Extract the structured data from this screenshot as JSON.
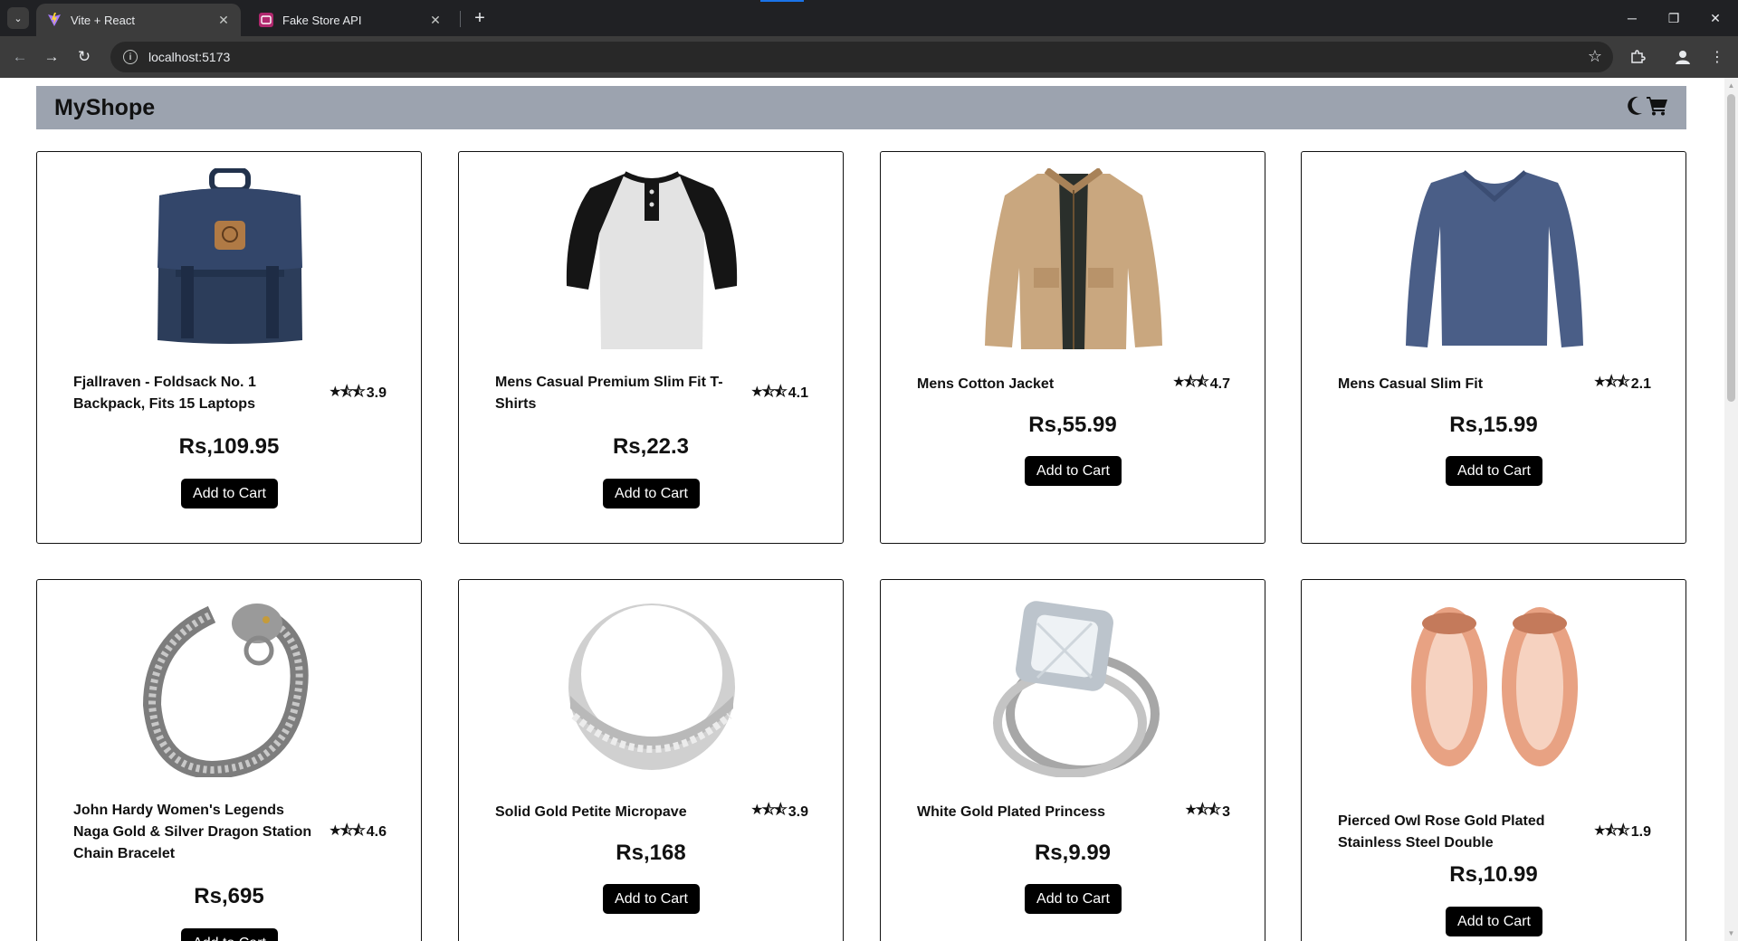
{
  "browser": {
    "tabs": [
      {
        "title": "Vite + React",
        "icon": "vite-icon",
        "active": true
      },
      {
        "title": "Fake Store API",
        "icon": "fakestore-icon",
        "active": false
      }
    ],
    "url": "localhost:5173"
  },
  "app": {
    "brand": "MyShope",
    "icons": [
      "moon-icon",
      "cart-icon"
    ]
  },
  "products": [
    {
      "title": "Fjallraven - Foldsack No. 1 Backpack, Fits 15 Laptops",
      "rating": "3.9",
      "price": "Rs,109.95",
      "button": "Add to Cart",
      "image": "backpack"
    },
    {
      "title": "Mens Casual Premium Slim Fit T-Shirts",
      "rating": "4.1",
      "price": "Rs,22.3",
      "button": "Add to Cart",
      "image": "tshirt"
    },
    {
      "title": "Mens Cotton Jacket",
      "rating": "4.7",
      "price": "Rs,55.99",
      "button": "Add to Cart",
      "image": "jacket"
    },
    {
      "title": "Mens Casual Slim Fit",
      "rating": "2.1",
      "price": "Rs,15.99",
      "button": "Add to Cart",
      "image": "longsleeve"
    },
    {
      "title": "John Hardy Women's Legends Naga Gold & Silver Dragon Station Chain Bracelet",
      "rating": "4.6",
      "price": "Rs,695",
      "button": "Add to Cart",
      "image": "bracelet"
    },
    {
      "title": "Solid Gold Petite Micropave",
      "rating": "3.9",
      "price": "Rs,168",
      "button": "Add to Cart",
      "image": "band-ring"
    },
    {
      "title": "White Gold Plated Princess",
      "rating": "3",
      "price": "Rs,9.99",
      "button": "Add to Cart",
      "image": "diamond-ring"
    },
    {
      "title": "Pierced Owl Rose Gold Plated Stainless Steel Double",
      "rating": "1.9",
      "price": "Rs,10.99",
      "button": "Add to Cart",
      "image": "rose-gold-plugs"
    }
  ]
}
